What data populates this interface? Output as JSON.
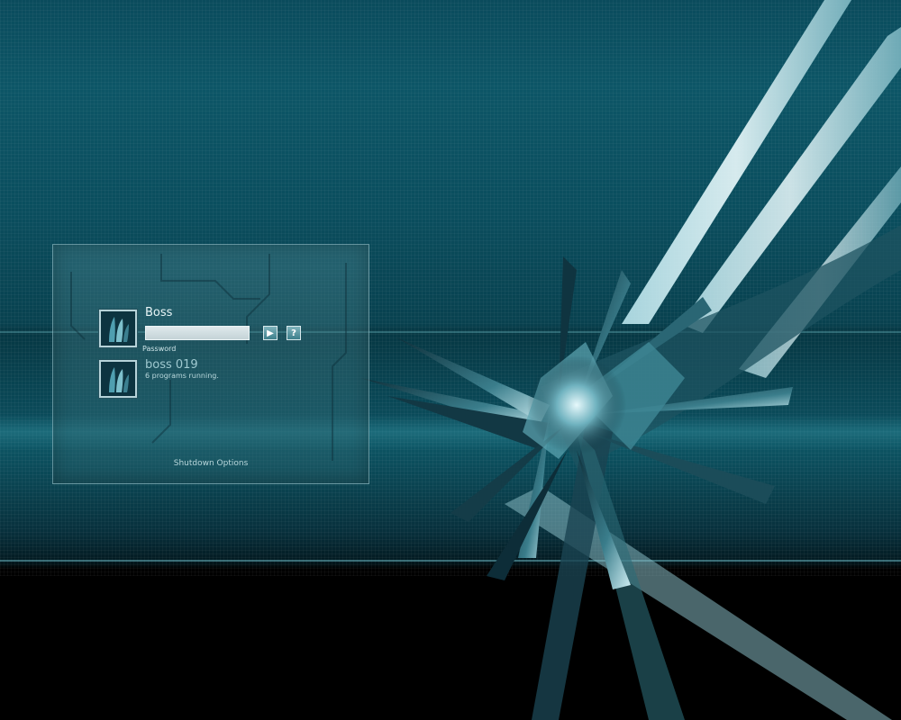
{
  "login": {
    "users": [
      {
        "name": "Boss",
        "password_label": "Password",
        "password_value": "",
        "avatar_icon": "blades-avatar-icon"
      },
      {
        "name": "boss 019",
        "status": "6 programs running.",
        "avatar_icon": "blades-avatar-icon"
      }
    ],
    "go_button": "▶",
    "hint_button": "?",
    "shutdown_label": "Shutdown Options"
  },
  "colors": {
    "background_top": "#0c5566",
    "background_bottom": "#000000",
    "panel_border": "#b6d3d9",
    "text": "#e8f5f7"
  }
}
